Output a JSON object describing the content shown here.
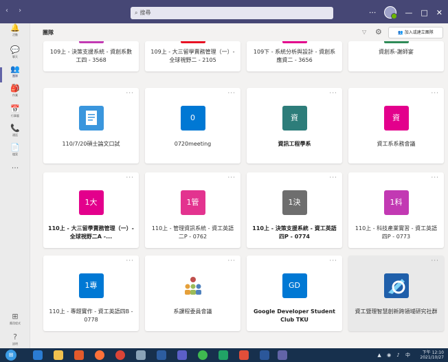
{
  "app": {
    "search_placeholder": "搜尋",
    "page_title": "團隊",
    "join_button": "加入或建立團隊",
    "more_label": "···",
    "window_controls": [
      "···",
      "—",
      "□",
      "✕"
    ]
  },
  "rail": [
    {
      "icon": "bell-icon",
      "glyph": "🔔",
      "label": "活動"
    },
    {
      "icon": "chat-icon",
      "glyph": "💬",
      "label": "聊天"
    },
    {
      "icon": "teams-icon",
      "glyph": "👥",
      "label": "團隊",
      "active": true
    },
    {
      "icon": "assignments-icon",
      "glyph": "🎒",
      "label": "作業"
    },
    {
      "icon": "calendar-icon",
      "glyph": "📅",
      "label": "行事曆"
    },
    {
      "icon": "calls-icon",
      "glyph": "📞",
      "label": "通話"
    },
    {
      "icon": "files-icon",
      "glyph": "📄",
      "label": "檔案"
    },
    {
      "icon": "more-apps-icon",
      "glyph": "···",
      "label": ""
    }
  ],
  "rail_bottom": [
    {
      "icon": "apps-icon",
      "glyph": "⊞",
      "label": "應用程式"
    },
    {
      "icon": "help-icon",
      "glyph": "?",
      "label": "說明"
    }
  ],
  "cards": [
    {
      "name": "109上 - 決策支援系統 - 資創系數工四 - 3568",
      "bar_color": "#c239b3",
      "partial": true
    },
    {
      "name": "109上 - 大三留學賣務管理（一）- 全球視野二 - 2105",
      "bar_color": "#e81123",
      "partial": true
    },
    {
      "name": "109下 - 系統分析與設計 - 資創系應資二 - 3656",
      "bar_color": "#e3008c",
      "partial": true
    },
    {
      "name": "資創系-謝師宴",
      "bar_color": "#2e8b57",
      "partial": true
    },
    {
      "name": "110/7/20碩士論文口試",
      "tile_text": "",
      "tile_color": "#3a96dd",
      "tile_icon": "document-icon"
    },
    {
      "name": "0720meeting",
      "tile_text": "0",
      "tile_color": "#0078d4"
    },
    {
      "name": "資訊工程學系",
      "tile_text": "資",
      "tile_color": "#2d7d7a",
      "bold": true
    },
    {
      "name": "資工系系務會議",
      "tile_text": "資",
      "tile_color": "#e3008c"
    },
    {
      "name": "110上 - 大三留學賣務管理（一）- 全球視野二A -...",
      "tile_text": "1大",
      "tile_color": "#e3008c",
      "bold": true
    },
    {
      "name": "110上 - 管理資訊系統 - 資工英語二P - 0762",
      "tile_text": "1管",
      "tile_color": "#e3338f"
    },
    {
      "name": "110上 - 決策支援系統 - 資工英語四P - 0774",
      "tile_text": "1決",
      "tile_color": "#6e6e6e",
      "bold": true
    },
    {
      "name": "110上 - 科技產業實習 - 資工英語四P - 0773",
      "tile_text": "1科",
      "tile_color": "#c239b3"
    },
    {
      "name": "110上 - 專題實作 - 資工英語四B - 0778",
      "tile_text": "1專",
      "tile_color": "#0078d4"
    },
    {
      "name": "系課程委員會議",
      "tile_text": "",
      "tile_color": "#ffffff",
      "tile_icon": "people-group-icon"
    },
    {
      "name": "Google Developer Student Club TKU",
      "tile_text": "GD",
      "tile_color": "#0078d4",
      "bold": true
    },
    {
      "name": "資工暨理智慧創新跨領域研究社群",
      "tile_text": "",
      "tile_color": "#1f5faa",
      "tile_icon": "logo-icon",
      "selected": true
    }
  ],
  "taskbar": {
    "time": "下午 12:10",
    "date": "2021/10/27"
  }
}
